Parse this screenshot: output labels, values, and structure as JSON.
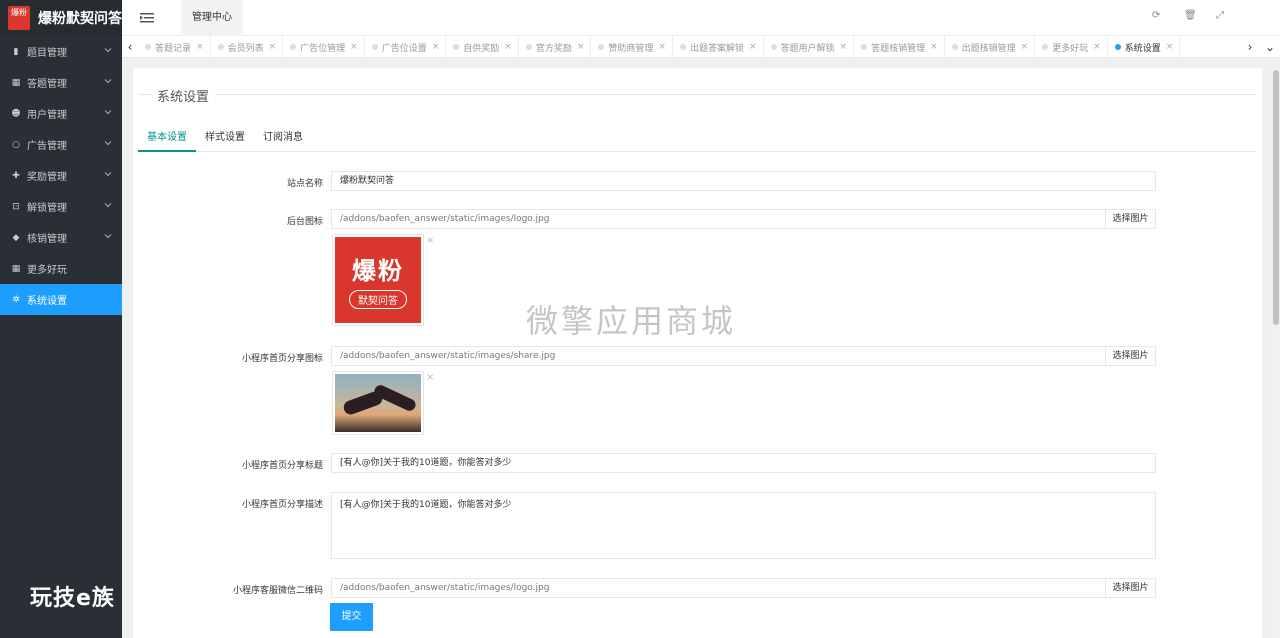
{
  "app": {
    "logo_mark": "爆粉",
    "title": "爆粉默契问答"
  },
  "sidebar": {
    "items": [
      {
        "label": "题目管理",
        "icon": "book-icon"
      },
      {
        "label": "答题管理",
        "icon": "calendar-icon"
      },
      {
        "label": "用户管理",
        "icon": "users-icon"
      },
      {
        "label": "广告管理",
        "icon": "circle-icon"
      },
      {
        "label": "奖励管理",
        "icon": "gift-icon"
      },
      {
        "label": "解锁管理",
        "icon": "cart-icon"
      },
      {
        "label": "核销管理",
        "icon": "tag-icon"
      },
      {
        "label": "更多好玩",
        "icon": "grid-icon"
      },
      {
        "label": "系统设置",
        "icon": "gear-icon",
        "active": true
      }
    ]
  },
  "topbar": {
    "tab": "管理中心"
  },
  "tabbar": {
    "tabs": [
      "答题记录",
      "会员列表",
      "广告位管理",
      "广告位设置",
      "自供奖励",
      "官方奖励",
      "赞助商管理",
      "出题答案解锁",
      "答题用户解锁",
      "答题核销管理",
      "出题核销管理",
      "更多好玩",
      "系统设置"
    ],
    "active_tab": "系统设置"
  },
  "page": {
    "legend": "系统设置",
    "subtabs": [
      "基本设置",
      "样式设置",
      "订阅消息"
    ],
    "active_subtab": "基本设置"
  },
  "form": {
    "site_name_label": "站点名称",
    "site_name_value": "爆粉默契问答",
    "admin_icon_label": "后台图标",
    "admin_icon_value": "/addons/baofen_answer/static/images/logo.jpg",
    "pick_image": "选择图片",
    "logo_preview_big": "爆粉",
    "logo_preview_small": "默契问答",
    "share_icon_label": "小程序首页分享图标",
    "share_icon_value": "/addons/baofen_answer/static/images/share.jpg",
    "share_title_label": "小程序首页分享标题",
    "share_title_value": "[有人@你]关于我的10道题，你能答对多少",
    "share_desc_label": "小程序首页分享描述",
    "share_desc_value": "[有人@你]关于我的10道题，你能答对多少",
    "qrcode_label": "小程序客服微信二维码",
    "qrcode_value": "/addons/baofen_answer/static/images/logo.jpg",
    "close_mark": "×",
    "submit": "提交"
  },
  "watermarks": {
    "center": "微擎应用商城",
    "corner": "玩技e族"
  }
}
